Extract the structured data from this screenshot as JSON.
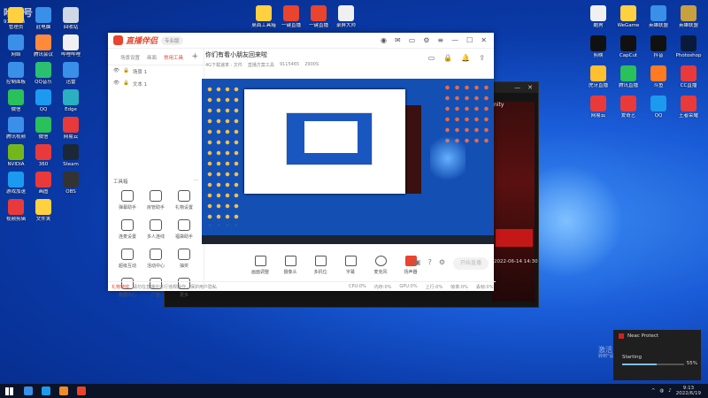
{
  "watermark": {
    "line1": "哈哈号",
    "line2": "9115465"
  },
  "desktop_icons_left": [
    {
      "label": "管理员",
      "color": "#ffd040"
    },
    {
      "label": "此电脑",
      "color": "#3a8fe8"
    },
    {
      "label": "回收站",
      "color": "#cfd8e4"
    },
    {
      "label": "网络",
      "color": "#3a8fe8"
    },
    {
      "label": "腾讯会议",
      "color": "#ff8a3a"
    },
    {
      "label": "哔哩哔哩",
      "color": "#f0f0f0"
    },
    {
      "label": "控制面板",
      "color": "#3a8fe8"
    },
    {
      "label": "QQ音乐",
      "color": "#2bc070"
    },
    {
      "label": "迅雷",
      "color": "#3a8fe8"
    },
    {
      "label": "微信",
      "color": "#2ac05a"
    },
    {
      "label": "QQ",
      "color": "#1b9af0"
    },
    {
      "label": "Edge",
      "color": "#2ab0c0"
    },
    {
      "label": "腾讯视频",
      "color": "#3a8fe8"
    },
    {
      "label": "微信",
      "color": "#2ac05a"
    },
    {
      "label": "网易云",
      "color": "#e83a3a"
    },
    {
      "label": "NVIDIA",
      "color": "#74b71b"
    },
    {
      "label": "360",
      "color": "#e83a3a"
    },
    {
      "label": "Steam",
      "color": "#1b2838"
    },
    {
      "label": "游戏加速",
      "color": "#1b9af0"
    },
    {
      "label": "画图",
      "color": "#e83a3a"
    },
    {
      "label": "OBS",
      "color": "#333"
    },
    {
      "label": "视频剪辑",
      "color": "#e83a3a"
    },
    {
      "label": "文件夹",
      "color": "#ffd040"
    }
  ],
  "desktop_icons_top": [
    {
      "label": "桌面工具箱",
      "color": "#ffd040"
    },
    {
      "label": "一键直播",
      "color": "#e8442e"
    },
    {
      "label": "一键直播",
      "color": "#e8442e"
    },
    {
      "label": "录屏大师",
      "color": "#f0f0f0"
    }
  ],
  "desktop_icons_right": [
    {
      "label": "酷狗",
      "color": "#f0f0f0"
    },
    {
      "label": "WeGame",
      "color": "#ffd040"
    },
    {
      "label": "英雄联盟",
      "color": "#3a8fe8"
    },
    {
      "label": "英雄联盟",
      "color": "#c8a040"
    },
    {
      "label": "剪映",
      "color": "#111"
    },
    {
      "label": "CapCut",
      "color": "#111"
    },
    {
      "label": "抖音",
      "color": "#111"
    },
    {
      "label": "Photoshop",
      "color": "#0a1a3a"
    },
    {
      "label": "虎牙直播",
      "color": "#ffc030"
    },
    {
      "label": "腾讯直播",
      "color": "#2ac05a"
    },
    {
      "label": "斗鱼",
      "color": "#ff7a20"
    },
    {
      "label": "CC直播",
      "color": "#e83a3a"
    },
    {
      "label": "网易云",
      "color": "#e83a3a"
    },
    {
      "label": "爱奇艺",
      "color": "#e83a3a"
    },
    {
      "label": "QQ",
      "color": "#1b9af0"
    },
    {
      "label": "王者荣耀",
      "color": "#e83a3a"
    }
  ],
  "app": {
    "logo": "直播伴侣",
    "badge": "专业版",
    "tabs": [
      "场景设置",
      "画面",
      "常用工具"
    ],
    "scenes": [
      "场景 1",
      "文本 1"
    ],
    "tools_title": "工具箱",
    "tools": [
      "弹幕助手",
      "房管助手",
      "礼物设置",
      "连麦设置",
      "多人连线",
      "福袋助手",
      "超级互动",
      "活动中心",
      "抽奖",
      "数据中心",
      "广告",
      "更多"
    ],
    "room_title": "你们有看小朋友回来啦",
    "room_meta": [
      "4G下载速率 : 文件",
      "直播方案工具",
      "9115465",
      "2900S"
    ],
    "bottom_tools": [
      "画面调整",
      "摄像头",
      "多机位",
      "字幕",
      "麦克风",
      "扬声器"
    ],
    "go_live": "开始直播",
    "notice_tag": "礼物特效",
    "notice": "请勿在直播中进行违规操作，保护用户隐私",
    "stats": [
      "CPU:0%",
      "内存:0%",
      "GPU:0%",
      "上行:0%",
      "帧率:0%",
      "丢帧:0%"
    ]
  },
  "game": {
    "title": "nity",
    "time": "2022-06-14 14:30"
  },
  "notification": {
    "title": "Neac Protect",
    "status": "Starting",
    "percent": "55%",
    "progress": 0.55
  },
  "activation": {
    "line1": "激活 Windows",
    "line2": "转到\"设置\"以激活 Windows。"
  },
  "taskbar": {
    "time": "9:13",
    "date": "2022/6/19",
    "apps": [
      {
        "color": "#3a8fe8"
      },
      {
        "color": "#1b9af0"
      },
      {
        "color": "#f08a2a"
      },
      {
        "color": "#e8442e"
      }
    ]
  }
}
